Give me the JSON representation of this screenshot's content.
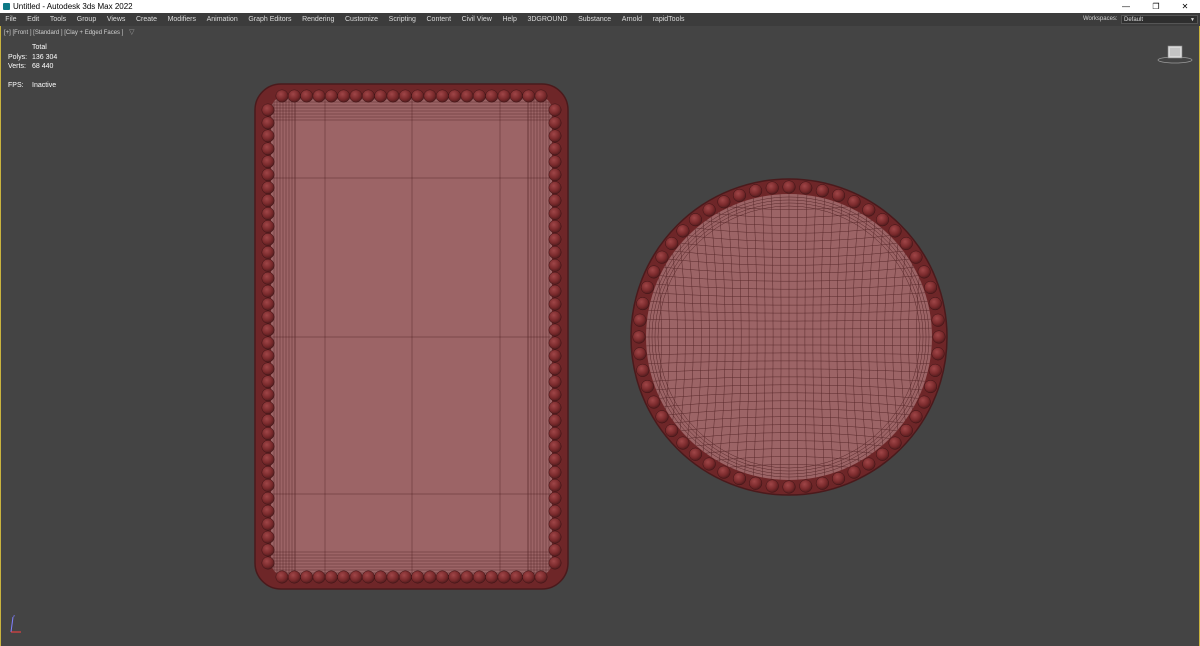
{
  "window": {
    "title": "Untitled - Autodesk 3ds Max 2022",
    "controls": {
      "minimize": "—",
      "restore": "❐",
      "close": "✕"
    }
  },
  "menubar": {
    "items": [
      "File",
      "Edit",
      "Tools",
      "Group",
      "Views",
      "Create",
      "Modifiers",
      "Animation",
      "Graph Editors",
      "Rendering",
      "Customize",
      "Scripting",
      "Content",
      "Civil View",
      "Help",
      "3DGROUND",
      "Substance",
      "Arnold",
      "rapidTools"
    ],
    "workspaces_label": "Workspaces:",
    "workspaces_value": "Default"
  },
  "viewport": {
    "label": "[+] [Front ] [Standard ] [Clay + Edged Faces ]",
    "filter_icon": "funnel-icon",
    "stats": {
      "header": "Total",
      "polys_label": "Polys:",
      "polys_value": "136 304",
      "verts_label": "Verts:",
      "verts_value": "68 440",
      "fps_label": "FPS:",
      "fps_value": "Inactive"
    },
    "viewcube_icon": "viewcube-icon",
    "axis_icon": "axis-tripod-icon"
  },
  "colors": {
    "viewport_bg": "#444444",
    "mesh_fill": "#9c6466",
    "mesh_wire": "#5a2a2c",
    "bead": "#7a2a2c",
    "active_border": "#c9b33e",
    "menubar_bg": "#3c3c3c"
  }
}
